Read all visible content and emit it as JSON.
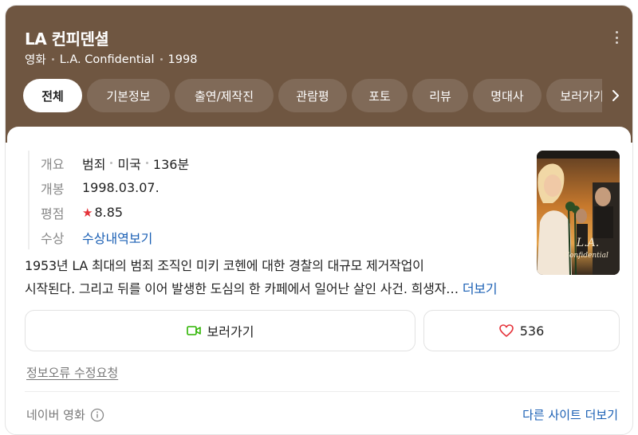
{
  "header": {
    "title": "LA 컨피덴셜",
    "meta": [
      "영화",
      "L.A. Confidential",
      "1998"
    ]
  },
  "tabs": [
    {
      "label": "전체",
      "active": true
    },
    {
      "label": "기본정보"
    },
    {
      "label": "출연/제작진"
    },
    {
      "label": "관람평"
    },
    {
      "label": "포토"
    },
    {
      "label": "리뷰"
    },
    {
      "label": "명대사"
    },
    {
      "label": "보러가기"
    }
  ],
  "info": {
    "overview_label": "개요",
    "genre": "범죄",
    "country": "미국",
    "runtime": "136분",
    "release_label": "개봉",
    "release": "1998.03.07.",
    "rating_label": "평점",
    "rating": "8.85",
    "award_label": "수상",
    "award_link": "수상내역보기"
  },
  "poster": {
    "alt_text": "L.A. Confidential"
  },
  "synopsis": {
    "line1": "1953년 LA 최대의 범죄 조직인 미키 코헨에 대한 경찰의 대규모 제거작업이",
    "line2": "시작된다. 그리고 뒤를 이어 발생한 도심의 한 카페에서 일어난 살인 사건. 희생자…",
    "more": "더보기"
  },
  "actions": {
    "watch": "보러가기",
    "likes": "536"
  },
  "footer": {
    "report": "정보오류 수정요청",
    "source": "네이버 영화",
    "more_sites": "다른 사이트 더보기"
  },
  "colors": {
    "header_bg": "#6f5641",
    "link": "#1a5fb4",
    "star": "#e5333a",
    "watch_icon": "#2db400",
    "heart_icon": "#e5333a"
  }
}
